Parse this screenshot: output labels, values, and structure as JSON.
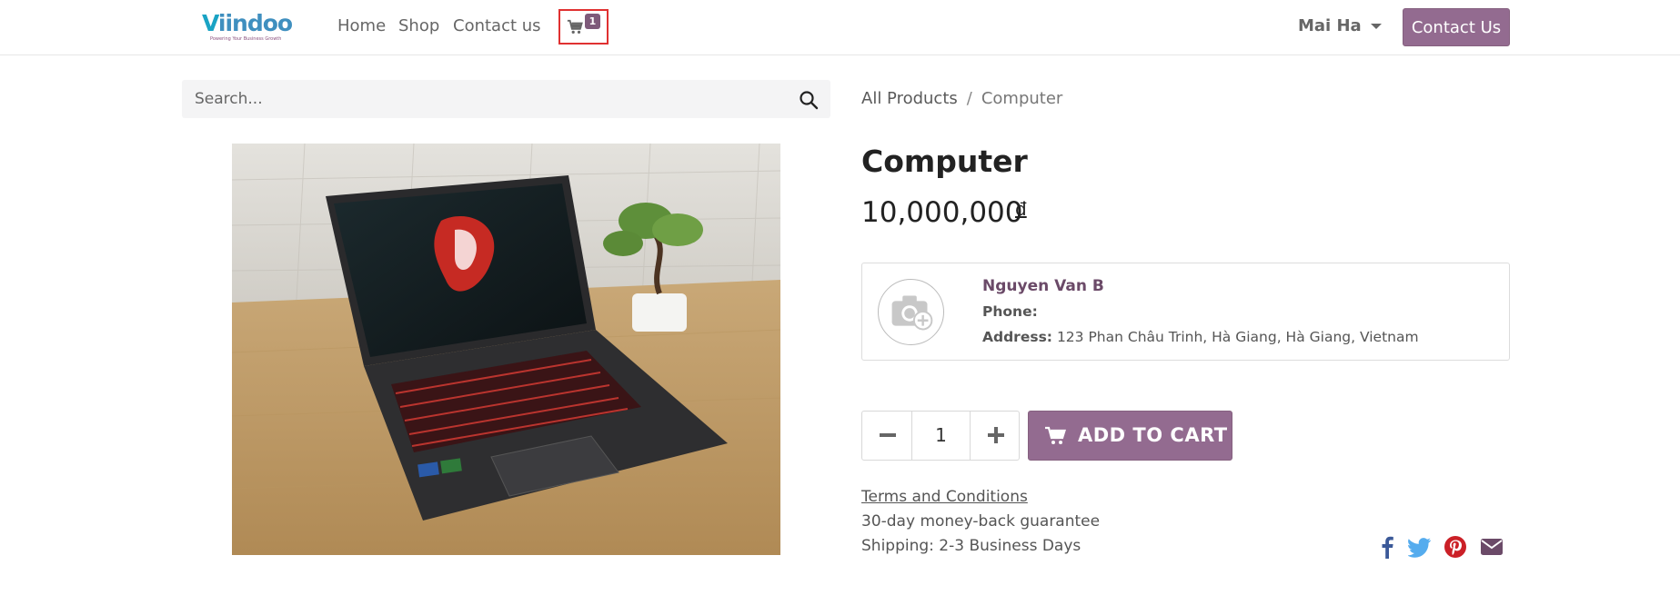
{
  "header": {
    "logo_text_v": "V",
    "logo_text_rest": "iindoo",
    "logo_tagline": "Powering Your Business Growth",
    "nav": [
      {
        "label": "Home"
      },
      {
        "label": "Shop"
      },
      {
        "label": "Contact us"
      }
    ],
    "cart_count": "1",
    "user_name": "Mai Ha",
    "contact_button": "Contact Us"
  },
  "search": {
    "placeholder": "Search..."
  },
  "breadcrumb": {
    "all_products": "All Products",
    "separator": "/",
    "current": "Computer"
  },
  "product": {
    "title": "Computer",
    "price": "10,000,000",
    "currency": "đ",
    "image_icon": "laptop-product-photo"
  },
  "seller": {
    "name": "Nguyen Van B",
    "phone_label": "Phone:",
    "phone_value": "",
    "address_label": "Address:",
    "address_value": "123 Phan Châu Trinh, Hà Giang, Hà Giang, Vietnam"
  },
  "cart_form": {
    "quantity": "1",
    "add_to_cart": "ADD TO CART"
  },
  "info": {
    "terms": "Terms and Conditions",
    "guarantee": "30-day money-back guarantee",
    "shipping": "Shipping: 2-3 Business Days"
  },
  "colors": {
    "brand": "#936b90",
    "highlight": "#e03131",
    "facebook": "#3b5998",
    "twitter": "#55acee",
    "pinterest": "#cb2027",
    "email": "#6b4a68"
  },
  "social_icons": [
    "facebook-icon",
    "twitter-icon",
    "pinterest-icon",
    "email-icon"
  ]
}
